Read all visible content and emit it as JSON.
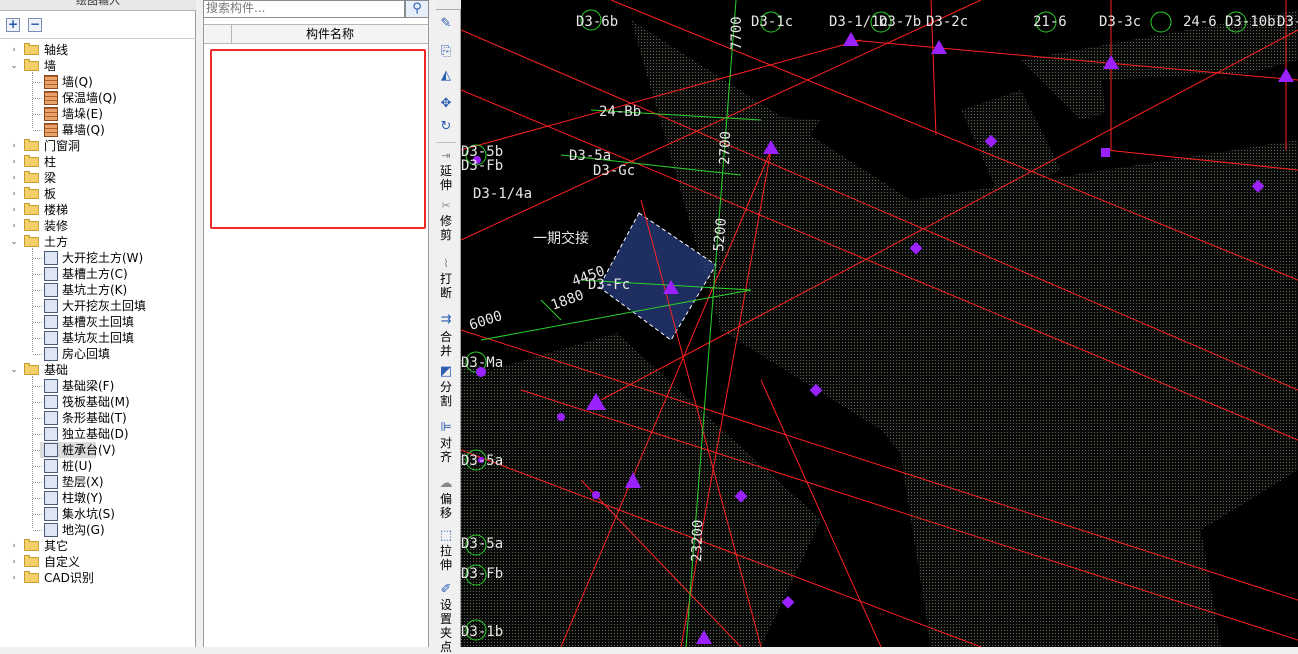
{
  "left_panel": {
    "title": "绘图输入",
    "add_btn": "+",
    "remove_btn": "−",
    "tree": [
      {
        "label": "轴线"
      },
      {
        "label": "墙",
        "children": [
          "墙(Q)",
          "保温墙(Q)",
          "墙垛(E)",
          "幕墙(Q)"
        ]
      },
      {
        "label": "门窗洞"
      },
      {
        "label": "柱"
      },
      {
        "label": "梁"
      },
      {
        "label": "板"
      },
      {
        "label": "楼梯"
      },
      {
        "label": "装修"
      },
      {
        "label": "土方",
        "children": [
          "大开挖土方(W)",
          "基槽土方(C)",
          "基坑土方(K)",
          "大开挖灰土回填",
          "基槽灰土回填",
          "基坑灰土回填",
          "房心回填"
        ]
      },
      {
        "label": "基础",
        "children": [
          "基础梁(F)",
          "筏板基础(M)",
          "条形基础(T)",
          "独立基础(D)",
          "桩承台(V)",
          "桩(U)",
          "垫层(X)",
          "柱墩(Y)",
          "集水坑(S)",
          "地沟(G)"
        ]
      },
      {
        "label": "其它"
      },
      {
        "label": "自定义"
      },
      {
        "label": "CAD识别"
      }
    ],
    "selected": "桩承台(V)"
  },
  "mid_panel": {
    "search_placeholder": "搜索构件...",
    "column_header": "构件名称"
  },
  "toolbar": {
    "tools": [
      "延伸",
      "修剪",
      "打断",
      "合并",
      "分割",
      "对齐",
      "偏移",
      "拉伸",
      "设置夹点"
    ]
  },
  "canvas": {
    "labels": [
      {
        "text": "D3-6b"
      },
      {
        "text": "D3-1c"
      },
      {
        "text": "D3-1/1c"
      },
      {
        "text": "D3-7b"
      },
      {
        "text": "D3-2c"
      },
      {
        "text": "21-6"
      },
      {
        "text": "D3-3c"
      },
      {
        "text": "24-6"
      },
      {
        "text": "D3-10b"
      },
      {
        "text": "D3-"
      },
      {
        "text": "7700"
      },
      {
        "text": "24-Bb"
      },
      {
        "text": "2700"
      },
      {
        "text": "D3-5a"
      },
      {
        "text": "D3-Gc"
      },
      {
        "text": "D3-5b"
      },
      {
        "text": "D3-Fb"
      },
      {
        "text": "D3-1/4a"
      },
      {
        "text": "一期交接"
      },
      {
        "text": "5200"
      },
      {
        "text": "4450"
      },
      {
        "text": "D3-Fc"
      },
      {
        "text": "1880"
      },
      {
        "text": "6000"
      },
      {
        "text": "D3-Ma"
      },
      {
        "text": "D3-5a"
      },
      {
        "text": "23200"
      },
      {
        "text": "D3-5a"
      },
      {
        "text": "D3-Fb"
      },
      {
        "text": "D3-1b"
      }
    ],
    "colors": {
      "grid_line": "#ff2020",
      "dim_line": "#2bd32b",
      "label": "#e6e6e6",
      "marker": "#9b22ff",
      "hatch": "#3a4a35"
    }
  }
}
